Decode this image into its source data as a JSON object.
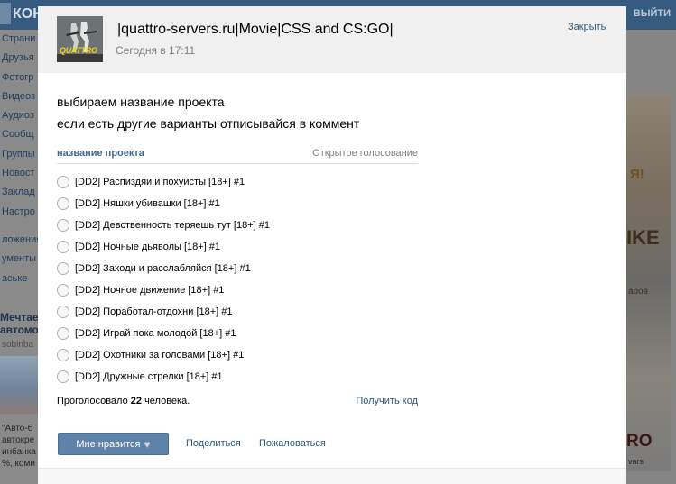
{
  "background": {
    "logo_text": "КОН",
    "logout_text": "ВЫЙТИ",
    "left_nav": [
      "Страни",
      "Друзья",
      "Фотогр",
      "Видеоз",
      "Аудиоз",
      "Сообщ",
      "Группы",
      "Новост",
      "Заклад",
      "Настро"
    ],
    "left_nav_more": [
      "ложения",
      "ументы",
      "аське"
    ],
    "ad_title": "Мечтае автомо",
    "ad_sub": "sobinba",
    "ad_text": [
      "\"Авто-б",
      "автокре",
      "инбанка",
      "%, коми"
    ],
    "banner_texts": [
      "Я!",
      "IKE",
      "аров",
      "RO",
      "vars"
    ]
  },
  "header": {
    "group_title": "|quattro-servers.ru|Movie|CSS and CS:GO|",
    "date": "Сегодня в 17:11",
    "close_label": "Закрыть",
    "avatar_text": "QUATTRO"
  },
  "post": {
    "lines": [
      "выбираем название проекта",
      "если есть другие варианты отписывайся в коммент"
    ]
  },
  "poll": {
    "question": "название проекта",
    "type": "Открытое голосование",
    "options": [
      "[DD2] Распиздяи и похуисты [18+] #1",
      "[DD2] Няшки убивашки [18+] #1",
      "[DD2] Девственность теряешь тут [18+] #1",
      "[DD2] Ночные дьяволы [18+] #1",
      "[DD2] Заходи и расслабляйся [18+] #1",
      "[DD2] Ночное движение [18+] #1",
      "[DD2] Поработал-отдохни [18+] #1",
      "[DD2] Играй пока молодой [18+] #1",
      "[DD2] Охотники за головами [18+] #1",
      "[DD2] Дружные стрелки [18+] #1"
    ],
    "voted_prefix": "Проголосовало",
    "voted_count": "22",
    "voted_suffix": "человека.",
    "get_code_label": "Получить код"
  },
  "actions": {
    "like_label": "Мне нравится",
    "share_label": "Поделиться",
    "report_label": "Пожаловаться"
  },
  "icons": {
    "like": "heart-icon",
    "radio": "radio-circle"
  },
  "colors": {
    "link": "#2b587a",
    "poll_question": "#45688e",
    "like_button": "#5e82a8",
    "header_bg": "#f0f0f0",
    "overlay": "#7c7c7c"
  }
}
